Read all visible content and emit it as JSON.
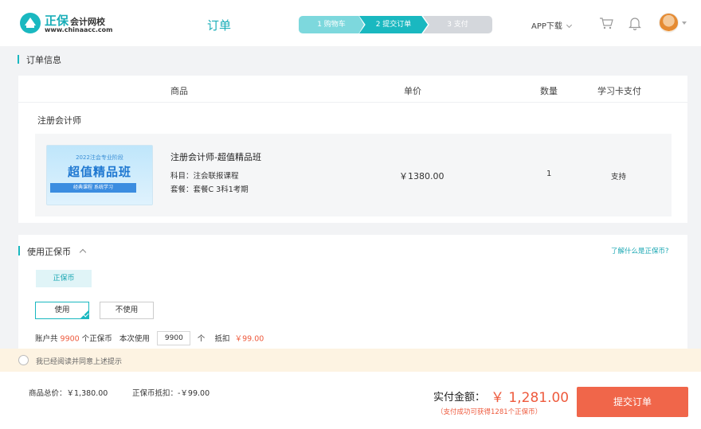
{
  "header": {
    "logo_cn": "正保",
    "logo_cn_small": "会计网校",
    "logo_url": "www.chinaacc.com",
    "page_title": "订单",
    "steps": [
      "1 购物车",
      "2 提交订单",
      "3 支付"
    ],
    "app_download": "APP下载"
  },
  "order": {
    "section_title": "订单信息",
    "columns": {
      "product": "商品",
      "unit_price": "单价",
      "quantity": "数量",
      "card_pay": "学习卡支付"
    },
    "group_title": "注册会计师",
    "item": {
      "thumb_top": "2022注会专业阶段",
      "thumb_main": "超值精品班",
      "thumb_bar": "经典课程 系统学习",
      "name": "注册会计师-超值精品班",
      "subject": "科目：注会联报课程",
      "package": "套餐：套餐C 3科1考期",
      "price": "￥1380.00",
      "quantity": "1",
      "card_support": "支持"
    }
  },
  "coin": {
    "section_title": "使用正保币",
    "help_link": "了解什么是正保币?",
    "tag": "正保币",
    "use_label": "使用",
    "nouse_label": "不使用",
    "account_prefix": "账户共",
    "account_amount": "9900",
    "account_suffix": "个正保币",
    "use_prefix": "本次使用",
    "use_value": "9900",
    "use_unit": "个",
    "deduct_label": "抵扣",
    "deduct_amount": "￥99.00"
  },
  "agree": {
    "text": "我已经阅读并同意上述提示"
  },
  "footer": {
    "goods_total": "商品总价：￥1,380.00",
    "coin_deduct": "正保币抵扣：-￥99.00",
    "pay_label": "实付金额：",
    "pay_amount": "￥ 1,281.00",
    "pay_note": "（支付成功可获得1281个正保币）",
    "submit_label": "提交订单"
  },
  "colors": {
    "accent": "#1ab8c0",
    "price_red": "#ee5a3d",
    "submit_bg": "#f0664a"
  }
}
